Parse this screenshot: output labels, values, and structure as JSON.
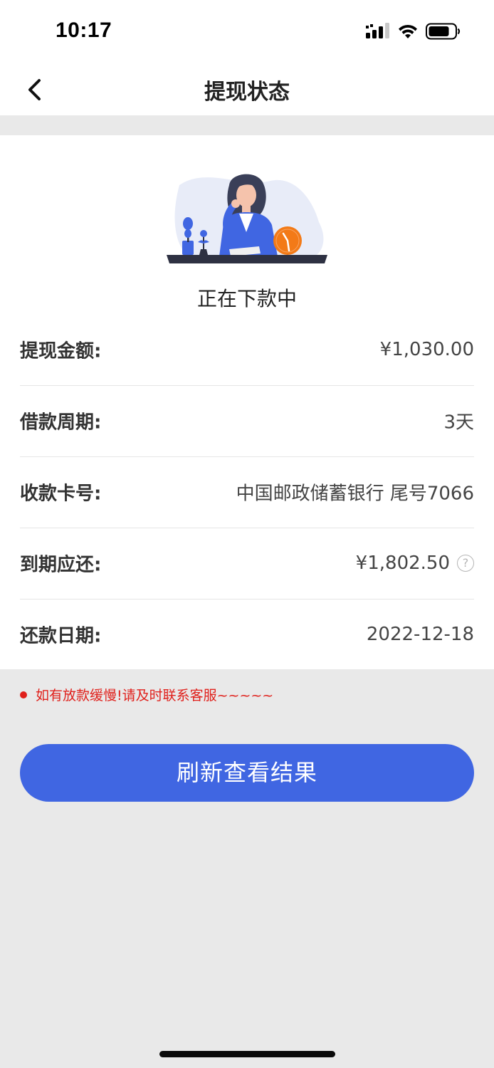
{
  "status_bar": {
    "time": "10:17",
    "icons": [
      "signal-icon",
      "wifi-icon",
      "battery-icon"
    ]
  },
  "nav": {
    "back_icon": "chevron-left-icon",
    "title": "提现状态"
  },
  "status": {
    "illustration": "waiting-woman-clock-illustration",
    "text": "正在下款中"
  },
  "details": {
    "amount_label": "提现金额:",
    "amount_value": "¥1,030.00",
    "period_label": "借款周期:",
    "period_value": "3天",
    "card_label": "收款卡号:",
    "card_value": "中国邮政储蓄银行 尾号7066",
    "due_label": "到期应还:",
    "due_value": "¥1,802.50",
    "help_icon": "question-circle-icon",
    "date_label": "还款日期:",
    "date_value": "2022-12-18"
  },
  "notice": {
    "text": "如有放款缓慢!请及时联系客服~~~~~"
  },
  "actions": {
    "refresh_label": "刷新查看结果"
  },
  "colors": {
    "accent": "#4066e2",
    "notice": "#e0201b",
    "page_bg": "#e9e9e9",
    "card_bg": "#ffffff",
    "clock": "#f37a17"
  }
}
